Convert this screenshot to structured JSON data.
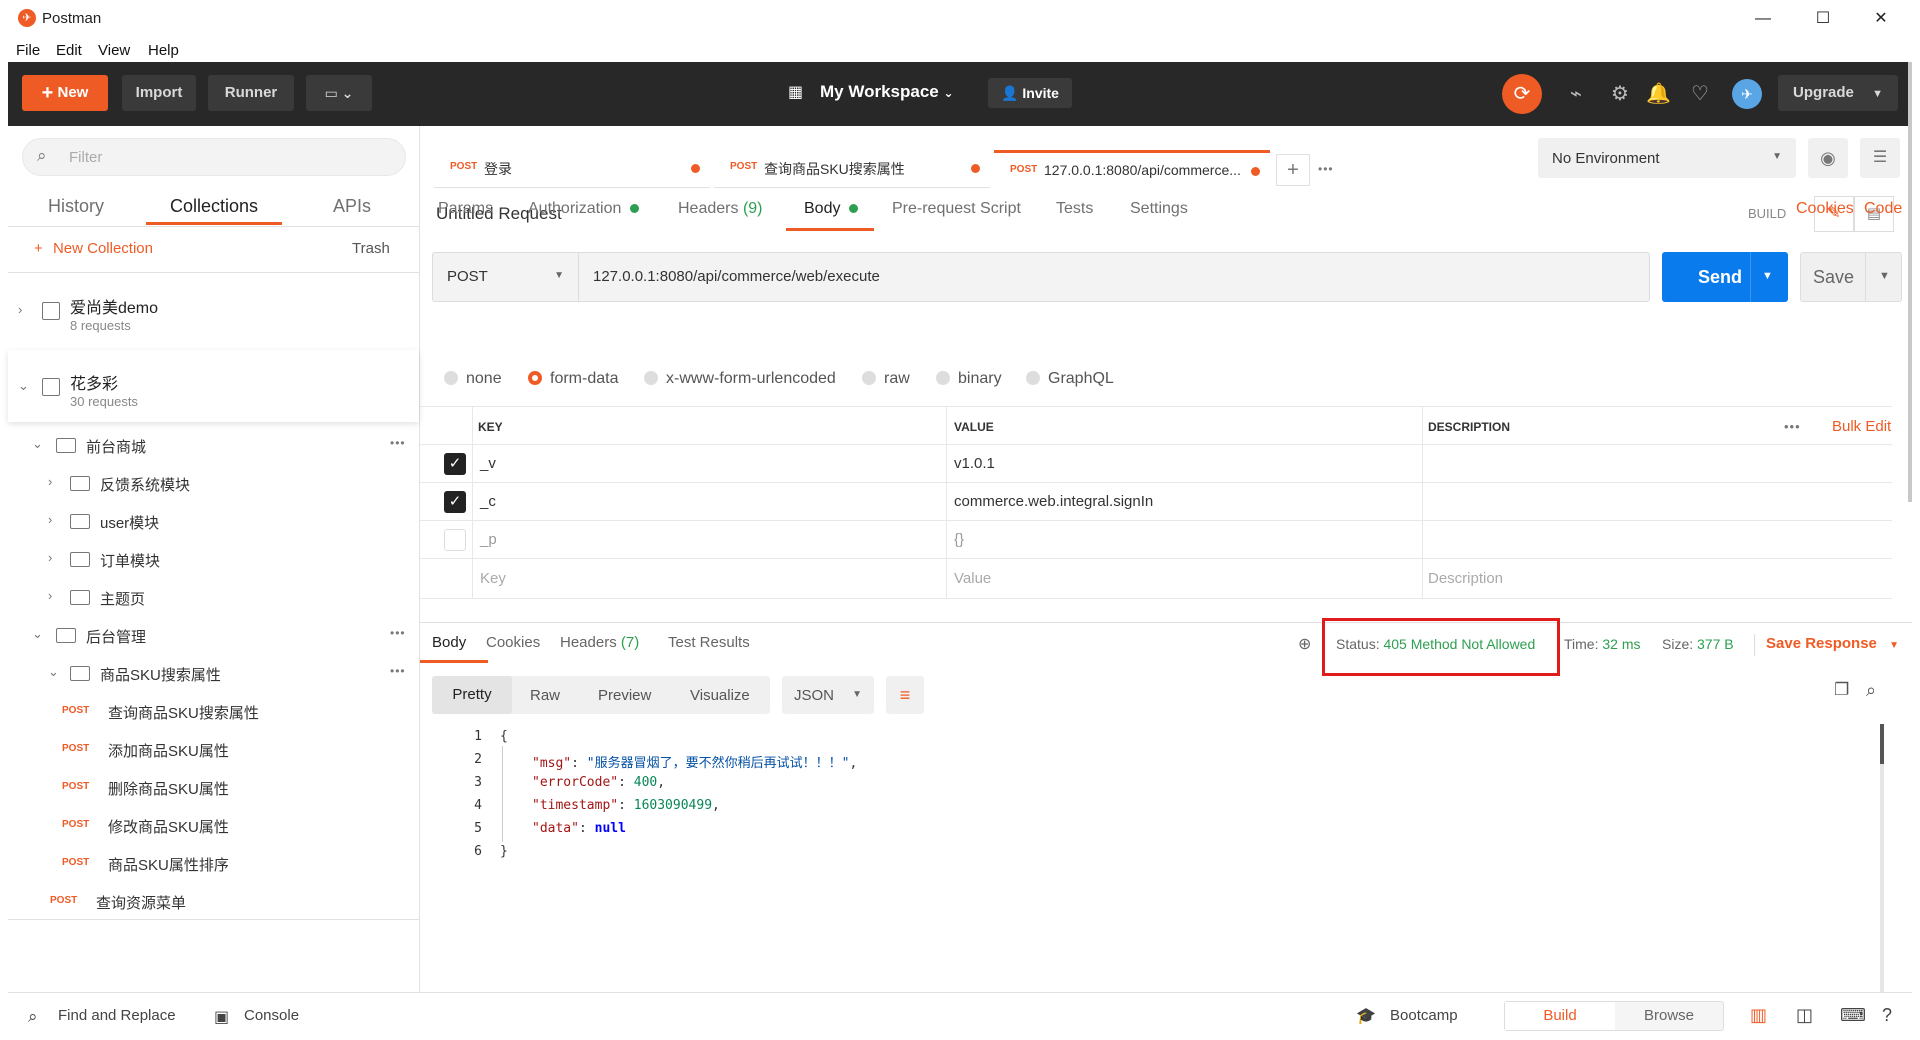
{
  "window": {
    "title": "Postman",
    "min": "—",
    "max": "☐",
    "close": "✕"
  },
  "menu": [
    "File",
    "Edit",
    "View",
    "Help"
  ],
  "header": {
    "new_label": "New",
    "import_label": "Import",
    "runner_label": "Runner",
    "workspace": "My Workspace",
    "invite_label": "Invite",
    "upgrade_label": "Upgrade"
  },
  "sidebar": {
    "filter_placeholder": "Filter",
    "tabs": [
      "History",
      "Collections",
      "APIs"
    ],
    "new_collection": "New Collection",
    "trash": "Trash",
    "collections": [
      {
        "name": "爱尚美demo",
        "count": "8 requests"
      },
      {
        "name": "花多彩",
        "count": "30 requests"
      }
    ],
    "tree": {
      "f1": "前台商城",
      "f1_children": [
        "反馈系统模块",
        "user模块",
        "订单模块",
        "主题页"
      ],
      "f2": "后台管理",
      "f2_sub": "商品SKU搜索属性",
      "requests": [
        "查询商品SKU搜索属性",
        "添加商品SKU属性",
        "删除商品SKU属性",
        "修改商品SKU属性",
        "商品SKU属性排序"
      ],
      "last": "查询资源菜单",
      "method": "POST"
    }
  },
  "tabs": [
    {
      "method": "POST",
      "name": "登录"
    },
    {
      "method": "POST",
      "name": "查询商品SKU搜索属性"
    },
    {
      "method": "POST",
      "name": "127.0.0.1:8080/api/commerce..."
    }
  ],
  "environment": "No Environment",
  "request": {
    "title": "Untitled Request",
    "build": "BUILD",
    "method": "POST",
    "url": "127.0.0.1:8080/api/commerce/web/execute",
    "send": "Send",
    "save": "Save",
    "subtabs": [
      "Params",
      "Authorization",
      "Headers",
      "(9)",
      "Body",
      "Pre-request Script",
      "Tests",
      "Settings"
    ],
    "cookies": "Cookies",
    "code": "Code",
    "body_types": [
      "none",
      "form-data",
      "x-www-form-urlencoded",
      "raw",
      "binary",
      "GraphQL"
    ],
    "table": {
      "headers": [
        "KEY",
        "VALUE",
        "DESCRIPTION"
      ],
      "bulk_edit": "Bulk Edit",
      "rows": [
        {
          "key": "_v",
          "value": "v1.0.1",
          "checked": true
        },
        {
          "key": "_c",
          "value": "commerce.web.integral.signIn",
          "checked": true
        },
        {
          "key": "_p",
          "value": "{}",
          "checked": false
        }
      ],
      "placeholders": [
        "Key",
        "Value",
        "Description"
      ]
    }
  },
  "response": {
    "tabs": [
      "Body",
      "Cookies",
      "Headers",
      "(7)",
      "Test Results"
    ],
    "status_label": "Status:",
    "status": "405 Method Not Allowed",
    "time_label": "Time:",
    "time": "32 ms",
    "size_label": "Size:",
    "size": "377 B",
    "save": "Save Response",
    "views": [
      "Pretty",
      "Raw",
      "Preview",
      "Visualize"
    ],
    "format": "JSON",
    "lines": [
      "1",
      "2",
      "3",
      "4",
      "5",
      "6"
    ],
    "json": {
      "open": "{",
      "msg_key": "\"msg\"",
      "msg_val": "\"服务器冒烟了，要不然你稍后再试试！！！\"",
      "err_key": "\"errorCode\"",
      "err_val": "400",
      "ts_key": "\"timestamp\"",
      "ts_val": "1603090499",
      "data_key": "\"data\"",
      "data_val": "null",
      "close": "}"
    }
  },
  "footer": {
    "find": "Find and Replace",
    "console": "Console",
    "bootcamp": "Bootcamp",
    "build": "Build",
    "browse": "Browse"
  },
  "colors": {
    "accent": "#ef5b25",
    "send": "#097bed",
    "status_ok": "#2e9f51",
    "highlight": "#e01b1b"
  }
}
